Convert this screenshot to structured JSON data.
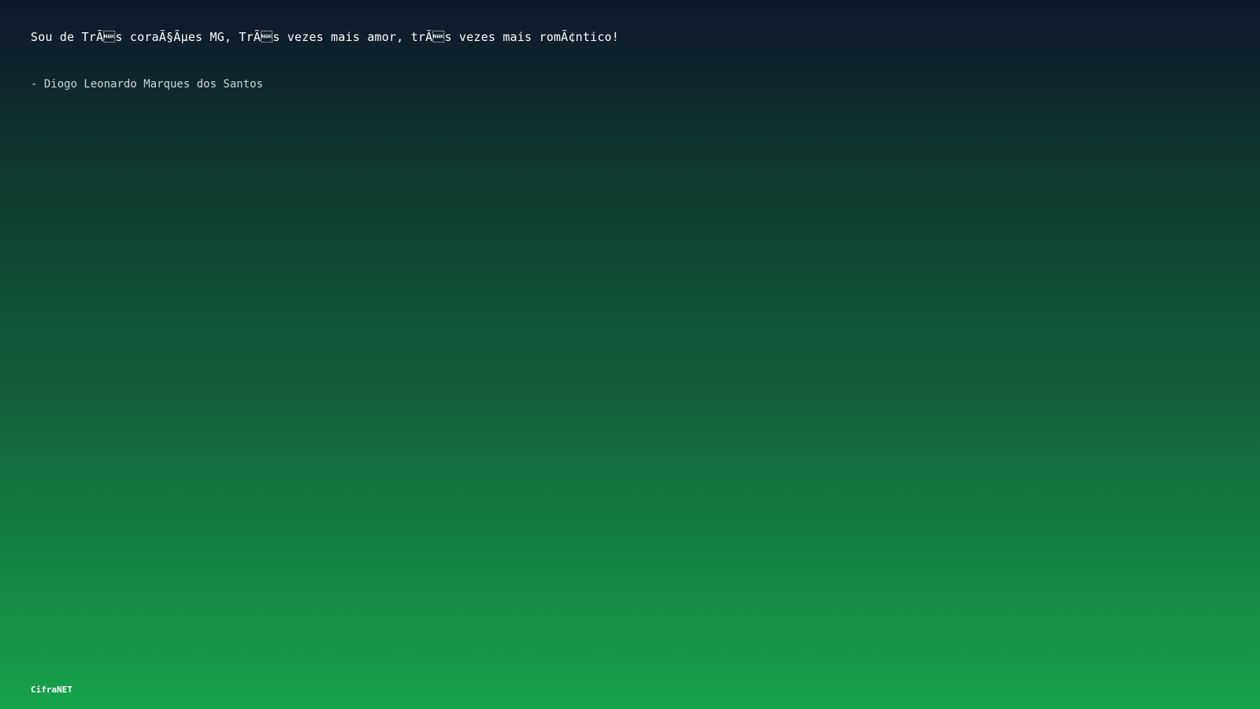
{
  "quote": {
    "text": "Sou de TrÃ\u0015s coraÃ§Ãµes MG, TrÃ\u0015s vezes mais amor, trÃ\u0015s vezes mais romÃ¢ntico!",
    "author": "- Diogo Leonardo Marques dos Santos"
  },
  "footer": {
    "brand": "CifraNET"
  }
}
